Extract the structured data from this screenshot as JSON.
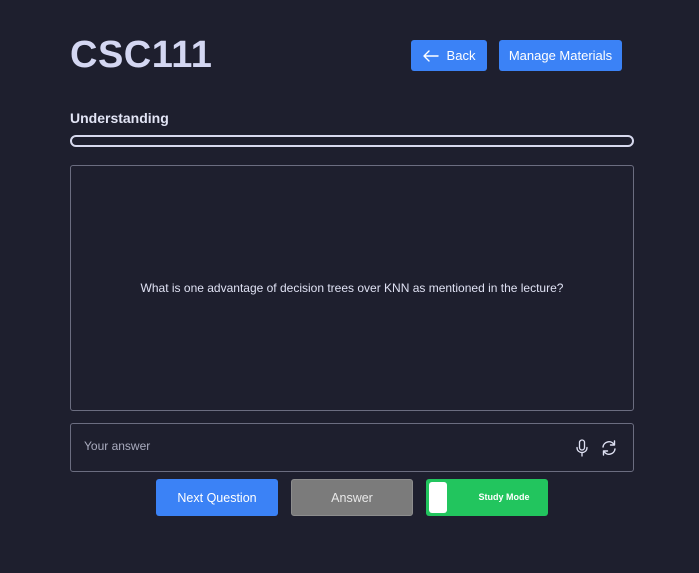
{
  "header": {
    "course_title": "CSC111",
    "back_label": "Back",
    "manage_label": "Manage Materials"
  },
  "section": {
    "label": "Understanding"
  },
  "progress": {
    "fraction": 0.0
  },
  "question": {
    "text": "What is one advantage of decision trees over KNN as mentioned in the lecture?"
  },
  "answer_field": {
    "value": "",
    "placeholder": "Your answer"
  },
  "actions": {
    "next_label": "Next Question",
    "answer_label": "Answer",
    "study_mode_label": "Study Mode"
  },
  "icons": {
    "back": "arrow-left-icon",
    "mic": "microphone-icon",
    "refresh": "refresh-icon"
  },
  "colors": {
    "background": "#1e1f2e",
    "primary": "#3b82f6",
    "toggle_on": "#22c55e",
    "answer_button": "#7b7b7b"
  }
}
